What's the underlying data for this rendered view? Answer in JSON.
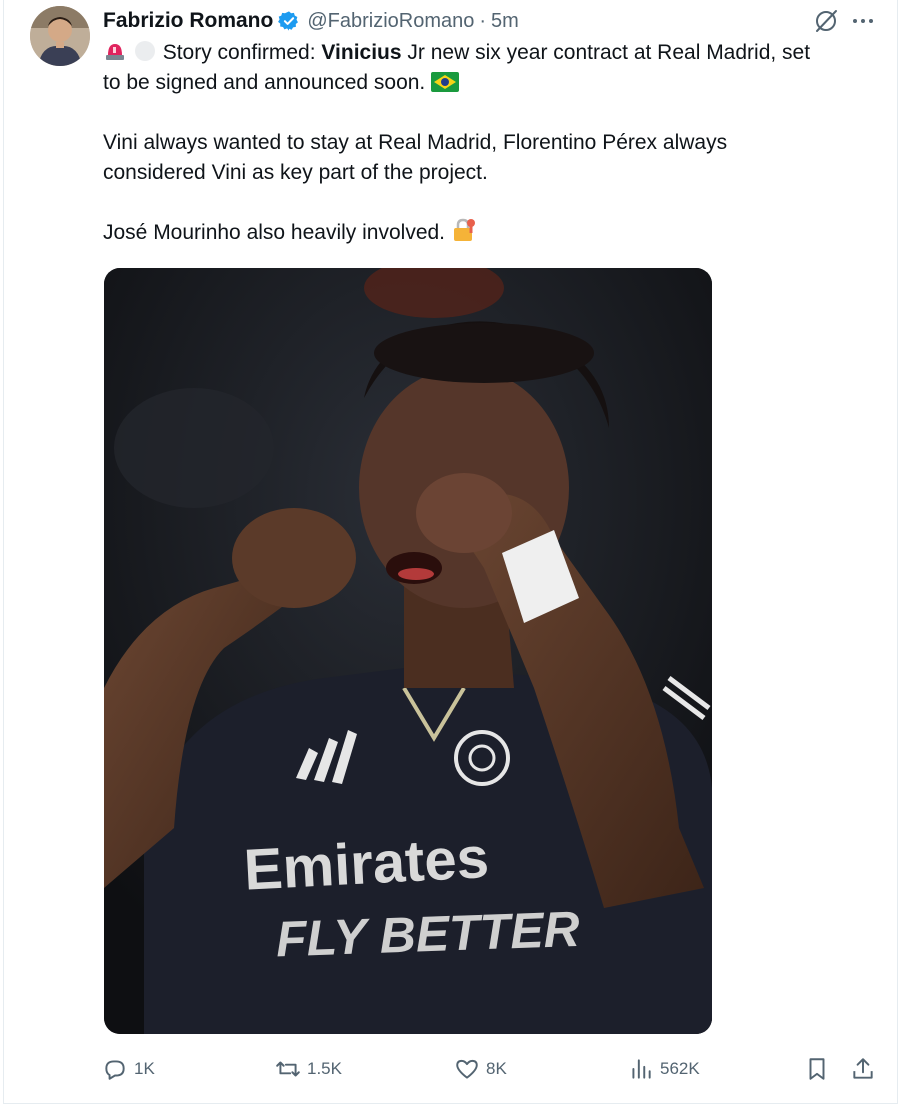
{
  "post": {
    "author_name": "Fabrizio Romano",
    "author_handle": "@FabrizioRomano",
    "separator": "·",
    "time_ago": "5m",
    "body": {
      "l1_pre": "Story confirmed: ",
      "l1_bold": "Vinicius",
      "l1_post": " Jr new six year contract at Real Madrid, set",
      "l2": "to be signed and announced soon.",
      "p2_l1": "Vini always wanted to stay at Real Madrid, Florentino Pérex always",
      "p2_l2": "considered Vini as key part of the project.",
      "p3": "José Mourinho also heavily involved."
    },
    "jersey": {
      "sponsor": "Emirates",
      "slogan": "FLY BETTER"
    }
  },
  "actions": {
    "replies": "1K",
    "reposts": "1.5K",
    "likes": "8K",
    "views": "562K"
  },
  "icons": {
    "verified": "verified-badge-icon",
    "grok": "grok-icon",
    "more": "more-horizontal-icon",
    "reply": "reply-icon",
    "repost": "repost-icon",
    "like": "heart-icon",
    "views": "views-chart-icon",
    "bookmark": "bookmark-icon",
    "share": "share-icon"
  },
  "colors": {
    "text": "#0f1419",
    "secondary": "#536471",
    "verified": "#1d9bf0"
  }
}
